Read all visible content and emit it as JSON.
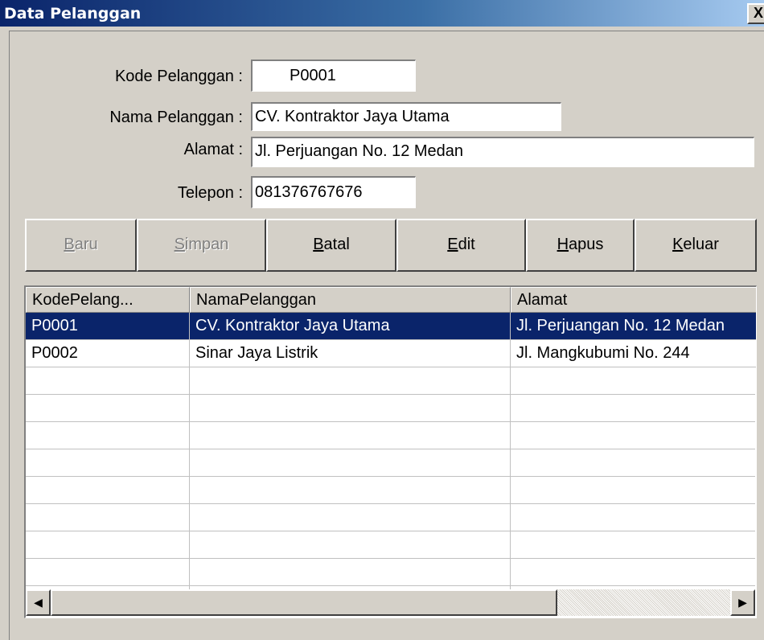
{
  "window": {
    "title": "Data Pelanggan",
    "close_glyph": "X"
  },
  "form": {
    "kode_label": "Kode Pelanggan :",
    "kode_value": "P0001",
    "nama_label": "Nama Pelanggan :",
    "nama_value": "CV. Kontraktor Jaya Utama",
    "alamat_label": "Alamat :",
    "alamat_value": "Jl. Perjuangan No. 12 Medan",
    "telepon_label": "Telepon :",
    "telepon_value": "081376767676"
  },
  "toolbar": {
    "baru": {
      "label": "Baru",
      "accelerator": "B",
      "enabled": false
    },
    "simpan": {
      "label": "Simpan",
      "accelerator": "S",
      "enabled": false
    },
    "batal": {
      "label": "Batal",
      "accelerator": "B",
      "enabled": true
    },
    "edit": {
      "label": "Edit",
      "accelerator": "E",
      "enabled": true
    },
    "hapus": {
      "label": "Hapus",
      "accelerator": "H",
      "enabled": true
    },
    "keluar": {
      "label": "Keluar",
      "accelerator": "K",
      "enabled": true
    }
  },
  "grid": {
    "columns": [
      "KodePelang...",
      "NamaPelanggan",
      "Alamat"
    ],
    "rows": [
      [
        "P0001",
        "CV. Kontraktor Jaya Utama",
        "Jl. Perjuangan No. 12 Medan"
      ],
      [
        "P0002",
        "Sinar Jaya Listrik",
        "Jl. Mangkubumi No. 244"
      ]
    ],
    "selected_row": 0,
    "scroll_left_glyph": "◀",
    "scroll_right_glyph": "▶"
  },
  "colors": {
    "titlebar_start": "#0a246a",
    "titlebar_end": "#a6caf0",
    "selection": "#0a246a",
    "face": "#d4d0c8"
  }
}
